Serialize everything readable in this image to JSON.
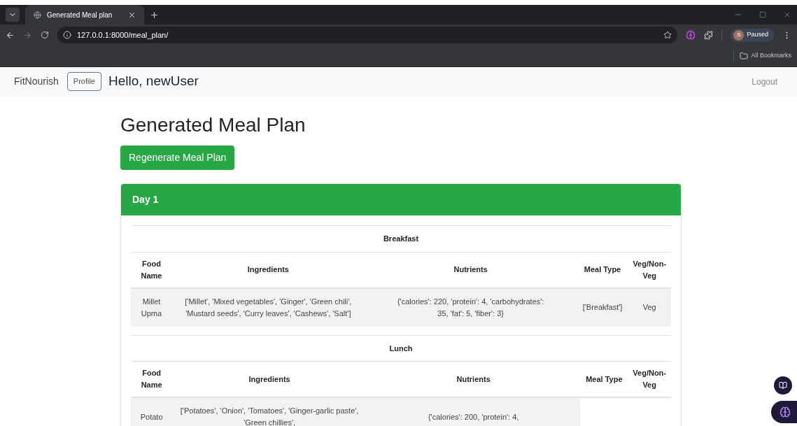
{
  "browser": {
    "tabs": [
      {
        "title": "Generated Meal plan",
        "selected": true
      }
    ],
    "url": "127.0.0.1:8000/meal_plan/",
    "profile": {
      "initial": "S",
      "label": "Paused"
    },
    "bookmarks": "All Bookmarks"
  },
  "navbar": {
    "brand": "FitNourish",
    "profile_button": "Profile",
    "greeting": "Hello, newUser",
    "logout": "Logout"
  },
  "title": "Generated Meal Plan",
  "regenerate_button": "Regenerate Meal Plan",
  "days": [
    {
      "title": "Day 1",
      "meals": [
        {
          "meal": "Breakfast",
          "columns": [
            "Food Name",
            "Ingredients",
            "Nutrients",
            "Meal Type",
            "Veg/Non-Veg"
          ],
          "rows": [
            [
              "Millet Upma",
              "['Millet', 'Mixed vegetables', 'Ginger', 'Green chili', 'Mustard seeds', 'Curry leaves', 'Cashews', 'Salt']",
              "{'calories': 220, 'protein': 4, 'carbohydrates': 35, 'fat': 5, 'fiber': 3}",
              "['Breakfast']",
              "Veg"
            ]
          ]
        },
        {
          "meal": "Lunch",
          "columns": [
            "Food Name",
            "Ingredients",
            "Nutrients",
            "Meal Type",
            "Veg/Non-Veg"
          ],
          "rows": [
            [
              "Potato",
              "['Potatoes', 'Onion', 'Tomatoes', 'Ginger-garlic paste', 'Green chillies',",
              "{'calories': 200, 'protein': 4,"
            ]
          ]
        }
      ]
    }
  ]
}
